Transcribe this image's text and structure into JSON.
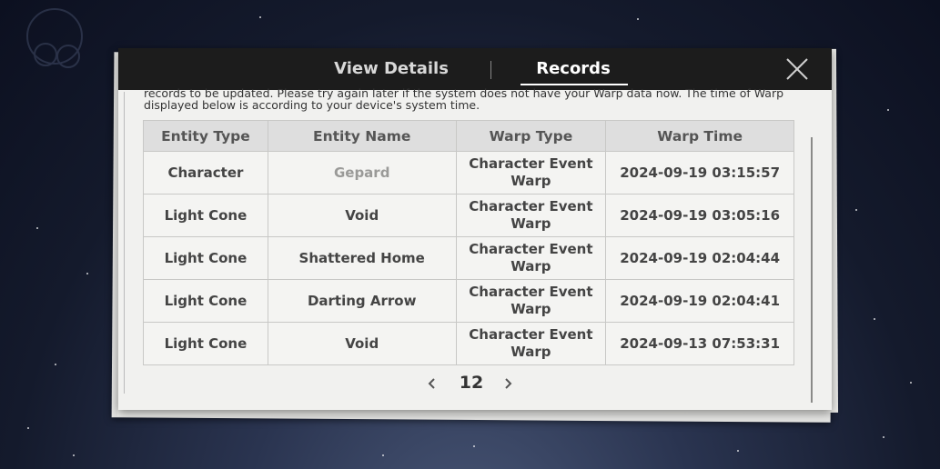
{
  "header": {
    "tabs": [
      {
        "label": "View Details",
        "active": false
      },
      {
        "label": "Records",
        "active": true
      }
    ]
  },
  "notice": {
    "line1": "records to be updated. Please try again later if the system does not have your Warp data now. The time of Warp",
    "line2": "displayed below is according to your device's system time."
  },
  "table": {
    "columns": [
      "Entity Type",
      "Entity Name",
      "Warp Type",
      "Warp Time"
    ],
    "rows": [
      {
        "type": "Character",
        "name": "Gepard",
        "warp_type": "Character Event Warp",
        "time": "2024-09-19 03:15:57"
      },
      {
        "type": "Light Cone",
        "name": "Void",
        "warp_type": "Character Event Warp",
        "time": "2024-09-19 03:05:16"
      },
      {
        "type": "Light Cone",
        "name": "Shattered Home",
        "warp_type": "Character Event Warp",
        "time": "2024-09-19 02:04:44"
      },
      {
        "type": "Light Cone",
        "name": "Darting Arrow",
        "warp_type": "Character Event Warp",
        "time": "2024-09-19 02:04:41"
      },
      {
        "type": "Light Cone",
        "name": "Void",
        "warp_type": "Character Event Warp",
        "time": "2024-09-13 07:53:31"
      }
    ]
  },
  "pager": {
    "page": "12",
    "prev_icon": "chevron-left-icon",
    "next_icon": "chevron-right-icon"
  },
  "colors": {
    "header_bg": "#1c1c1c",
    "card_bg": "#f1f1ef",
    "gold_name": "#9a9a98"
  }
}
